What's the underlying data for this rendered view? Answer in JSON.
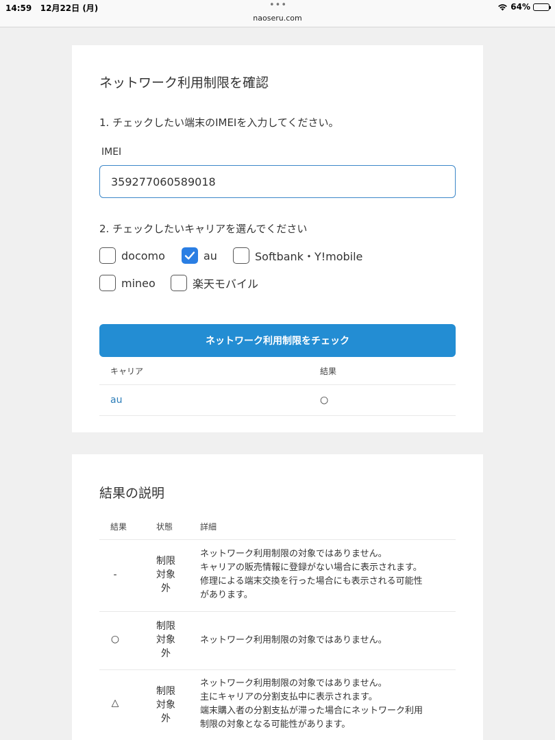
{
  "status_bar": {
    "time": "14:59",
    "date": "12月22日 (月)",
    "dots": "•••",
    "url": "naoseru.com",
    "battery_text": "64%",
    "battery_level": 0.64
  },
  "card1": {
    "heading": "ネットワーク利用制限を確認",
    "step1": "1. チェックしたい端末のIMEIを入力してください。",
    "imei_label": "IMEI",
    "imei_value": "359277060589018",
    "step2": "2. チェックしたいキャリアを選んでください",
    "carriers": [
      {
        "label": "docomo",
        "checked": false
      },
      {
        "label": "au",
        "checked": true
      },
      {
        "label": "Softbank・Y!mobile",
        "checked": false
      },
      {
        "label": "mineo",
        "checked": false
      },
      {
        "label": "楽天モバイル",
        "checked": false
      }
    ],
    "check_button": "ネットワーク利用制限をチェック",
    "result_table": {
      "headers": {
        "carrier": "キャリア",
        "result": "結果"
      },
      "row": {
        "carrier": "au",
        "result": "○"
      }
    }
  },
  "card2": {
    "heading": "結果の説明",
    "headers": {
      "result": "結果",
      "state": "状態",
      "detail": "詳細"
    },
    "rows": [
      {
        "result": "-",
        "state": [
          "制限",
          "対象",
          "外"
        ],
        "detail": [
          "ネットワーク利用制限の対象ではありません。",
          "キャリアの販売情報に登録がない場合に表示されます。",
          "修理による端末交換を行った場合にも表示される可能性",
          "があります。"
        ]
      },
      {
        "result": "○",
        "state": [
          "制限",
          "対象",
          "外"
        ],
        "detail": [
          "ネットワーク利用制限の対象ではありません。"
        ]
      },
      {
        "result": "△",
        "state": [
          "制限",
          "対象",
          "外"
        ],
        "detail": [
          "ネットワーク利用制限の対象ではありません。",
          "主にキャリアの分割支払中に表示されます。",
          "端末購入者の分割支払が滞った場合にネットワーク利用",
          "制限の対象となる可能性があります。"
        ]
      }
    ]
  }
}
